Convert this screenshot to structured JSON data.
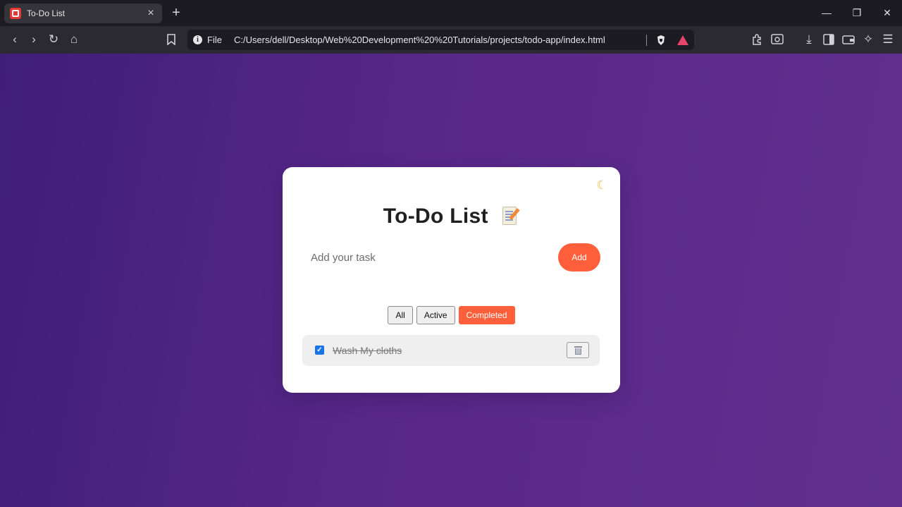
{
  "browser": {
    "tab_title": "To-Do List",
    "new_tab_symbol": "+",
    "url_scheme": "File",
    "url": "C:/Users/dell/Desktop/Web%20Development%20%20Tutorials/projects/todo-app/index.html",
    "window_controls": {
      "minimize": "—",
      "maximize": "❐",
      "close": "✕"
    },
    "toolbar_icons": [
      "back-icon",
      "forward-icon",
      "reload-icon",
      "home-icon",
      "bookmark-icon",
      "info-icon",
      "brave-shields-icon",
      "brave-rewards-icon",
      "extensions-icon",
      "page-search-icon",
      "download-icon",
      "sidebar-icon",
      "wallet-icon",
      "leo-ai-icon",
      "menu-icon"
    ]
  },
  "app": {
    "theme_toggle_icon": "moon-icon",
    "title": "To-Do List",
    "title_icon": "memo-icon",
    "input_placeholder": "Add your task",
    "input_value": "",
    "add_label": "Add",
    "filters": [
      {
        "label": "All",
        "active": false
      },
      {
        "label": "Active",
        "active": false
      },
      {
        "label": "Completed",
        "active": true
      }
    ],
    "tasks": [
      {
        "text": "Wash My cloths",
        "completed": true
      }
    ]
  },
  "colors": {
    "accent": "#ff5f3a",
    "background_gradient_start": "#3f1e7a",
    "background_gradient_end": "#61308e",
    "card": "#ffffff",
    "task_bg": "#efefef"
  }
}
